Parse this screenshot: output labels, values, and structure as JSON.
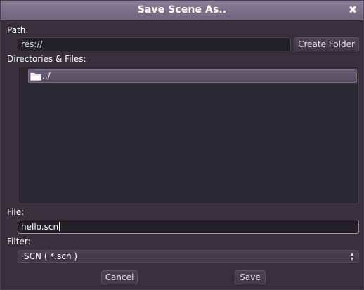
{
  "dialog": {
    "title": "Save Scene As..",
    "close_glyph": "✖"
  },
  "path": {
    "label": "Path:",
    "value": "res://",
    "create_folder_label": "Create Folder"
  },
  "files": {
    "label": "Directories & Files:",
    "items": [
      {
        "icon": "folder-icon",
        "label": "../"
      }
    ]
  },
  "file": {
    "label": "File:",
    "value": "hello.scn"
  },
  "filter": {
    "label": "Filter:",
    "selected": "SCN ( *.scn )"
  },
  "buttons": {
    "cancel_label": "Cancel",
    "save_label": "Save"
  },
  "colors": {
    "titlebar": "#7d7289",
    "panel": "#353039",
    "field": "#232027",
    "selection": "#5f556a"
  }
}
